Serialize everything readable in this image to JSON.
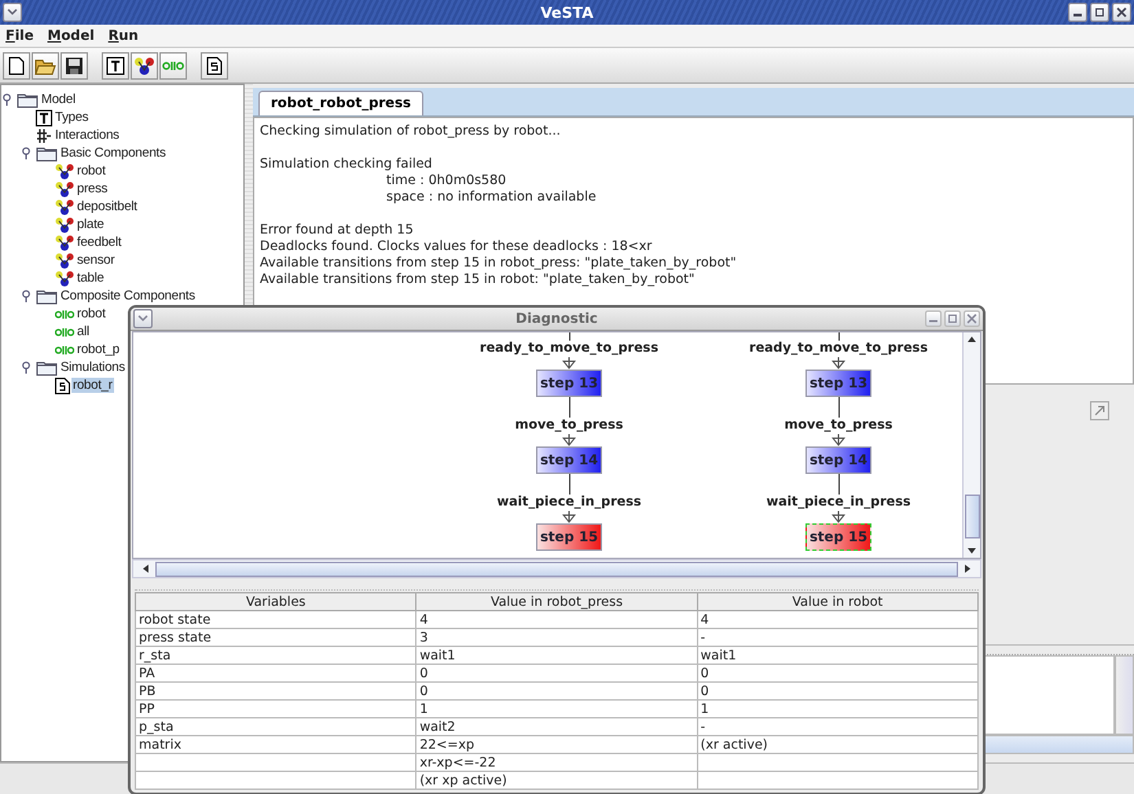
{
  "window": {
    "title": "VeSTA"
  },
  "menu": [
    "File",
    "Model",
    "Run"
  ],
  "toolbar": [
    {
      "kind": "new"
    },
    {
      "kind": "open"
    },
    {
      "kind": "save"
    },
    {
      "kind": "sep"
    },
    {
      "kind": "types"
    },
    {
      "kind": "component"
    },
    {
      "kind": "composite"
    },
    {
      "kind": "sep"
    },
    {
      "kind": "simulation"
    }
  ],
  "tree": {
    "label": "Model",
    "kind": "folder",
    "expanded": true,
    "selected": false,
    "children": [
      {
        "label": "Types",
        "kind": "types",
        "selected": false
      },
      {
        "label": "Interactions",
        "kind": "interactions",
        "selected": false
      },
      {
        "label": "Basic Components",
        "kind": "folder",
        "expanded": true,
        "selected": false,
        "children": [
          {
            "label": "robot",
            "kind": "component",
            "selected": false
          },
          {
            "label": "press",
            "kind": "component",
            "selected": false
          },
          {
            "label": "depositbelt",
            "kind": "component",
            "selected": false
          },
          {
            "label": "plate",
            "kind": "component",
            "selected": false
          },
          {
            "label": "feedbelt",
            "kind": "component",
            "selected": false
          },
          {
            "label": "sensor",
            "kind": "component",
            "selected": false
          },
          {
            "label": "table",
            "kind": "component",
            "selected": false
          }
        ]
      },
      {
        "label": "Composite Components",
        "kind": "folder",
        "expanded": true,
        "selected": false,
        "children": [
          {
            "label": "robot",
            "kind": "composite",
            "selected": false
          },
          {
            "label": "all",
            "kind": "composite",
            "selected": false
          },
          {
            "label": "robot_p",
            "kind": "composite",
            "selected": false
          }
        ]
      },
      {
        "label": "Simulations",
        "kind": "folder",
        "expanded": true,
        "selected": false,
        "children": [
          {
            "label": "robot_r",
            "kind": "simulation",
            "selected": true
          }
        ]
      }
    ]
  },
  "tabs": [
    {
      "label": "robot_robot_press",
      "selected": true
    }
  ],
  "output": [
    [
      {
        "text": "Checking simulation of robot_press by robot...",
        "indent": false
      }
    ],
    [
      {
        "text": "Simulation checking failed",
        "indent": false
      },
      {
        "text": "time : 0h0m0s580",
        "indent": true
      },
      {
        "text": "space : no information available",
        "indent": true
      }
    ],
    [
      {
        "text": "Error found at depth 15",
        "indent": false
      },
      {
        "text": "Deadlocks found. Clocks values for these deadlocks : 18<xr",
        "indent": false
      },
      {
        "text": "Available transitions from step 15 in robot_press: \"plate_taken_by_robot\"",
        "indent": false
      },
      {
        "text": "Available transitions from step 15 in robot: \"plate_taken_by_robot\"",
        "indent": false
      }
    ]
  ],
  "diagnostic": {
    "title": "Diagnostic",
    "columns": [
      {
        "steps": [
          {
            "transition": "ready_to_move_to_press",
            "step": "step 13",
            "kind": "ok",
            "selected": false
          },
          {
            "transition": "move_to_press",
            "step": "step 14",
            "kind": "ok",
            "selected": false
          },
          {
            "transition": "wait_piece_in_press",
            "step": "step 15",
            "kind": "error",
            "selected": false
          }
        ]
      },
      {
        "steps": [
          {
            "transition": "ready_to_move_to_press",
            "step": "step 13",
            "kind": "ok",
            "selected": false
          },
          {
            "transition": "move_to_press",
            "step": "step 14",
            "kind": "ok",
            "selected": false
          },
          {
            "transition": "wait_piece_in_press",
            "step": "step 15",
            "kind": "error",
            "selected": true
          }
        ]
      }
    ],
    "table": {
      "columns": [
        "Variables",
        "Value in robot_press",
        "Value in robot"
      ],
      "rows": [
        [
          "robot state",
          "4",
          "4"
        ],
        [
          "press state",
          "3",
          "-"
        ],
        [
          "r_sta",
          "wait1",
          "wait1"
        ],
        [
          "PA",
          "0",
          "0"
        ],
        [
          "PB",
          "0",
          "0"
        ],
        [
          "PP",
          "1",
          "1"
        ],
        [
          "p_sta",
          "wait2",
          "-"
        ],
        [
          "matrix",
          "22<=xp",
          "(xr active)"
        ],
        [
          null,
          "xr-xp<=-22",
          null
        ],
        [
          null,
          "(xr xp active)",
          null
        ]
      ]
    }
  }
}
